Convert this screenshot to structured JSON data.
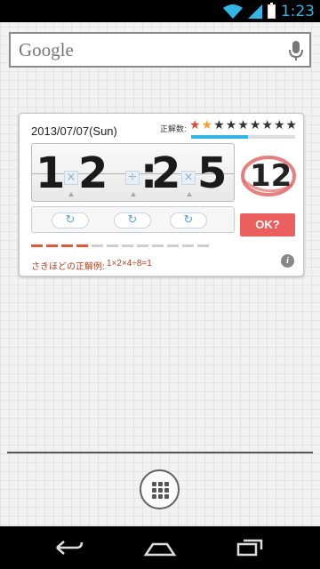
{
  "status_bar": {
    "time": "1:23",
    "icons": [
      "wifi-icon",
      "signal-icon",
      "battery-icon"
    ],
    "clock_color": "#33b5e5"
  },
  "search_widget": {
    "label": "Google",
    "icon": "mic-icon"
  },
  "puzzle_widget": {
    "date": "2013/07/07(Sun)",
    "correct_count_label": "正解数:",
    "stars": {
      "total": 9,
      "earned": [
        "red",
        "orange"
      ]
    },
    "progress_fraction": 0.55,
    "digits": [
      "1",
      "2",
      ":",
      "2",
      "5"
    ],
    "operators": [
      "×",
      "÷",
      "×"
    ],
    "target_answer": "12",
    "ok_button": "OK?",
    "progress_steps": {
      "total": 12,
      "done": 4
    },
    "previous_label": "さきほどの正解例:",
    "previous_example": "1×2×4÷8=1",
    "info_icon": "info-icon",
    "accent_red": "#ec5f5f",
    "accent_blue": "#33b5e5"
  },
  "dock": {
    "apps_icon": "all-apps-icon"
  },
  "nav_bar": {
    "icons": [
      "back-icon",
      "home-icon",
      "recent-apps-icon"
    ]
  }
}
